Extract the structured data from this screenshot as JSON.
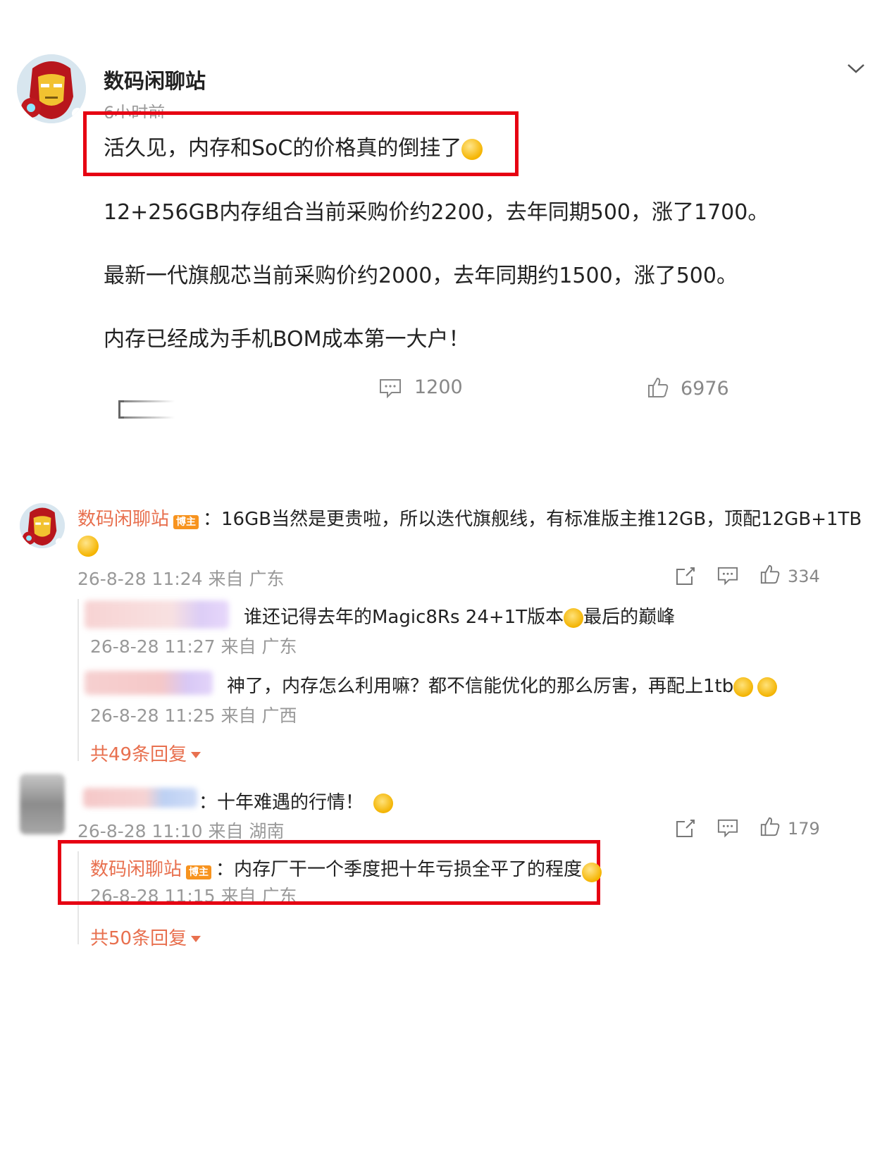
{
  "post": {
    "author": "数码闲聊站",
    "time": "6小时前",
    "lines": [
      "活久见，内存和SoC的价格真的倒挂了",
      "12+256GB内存组合当前采购价约2200，去年同期500，涨了1700。",
      "最新一代旗舰芯当前采购价约2000，去年同期约1500，涨了500。",
      "内存已经成为手机BOM成本第一大户！"
    ],
    "comment_count": "1200",
    "like_count": "6976"
  },
  "comments": [
    {
      "author": "数码闲聊站",
      "badge": "博主",
      "text": "：16GB当然是更贵啦，所以迭代旗舰线，有标准版主推12GB，顶配12GB+1TB",
      "meta": "26-8-28 11:24 来自 广东",
      "likes": "334",
      "replies": [
        {
          "text": "谁还记得去年的Magic8Rs 24+1T版本",
          "text_after": "最后的巅峰",
          "meta": "26-8-28 11:27 来自 广东"
        },
        {
          "text": "神了，内存怎么利用嘛？都不信能优化的那么厉害，再配上1tb",
          "meta": "26-8-28 11:25 来自 广西"
        }
      ],
      "reply_total": "共49条回复"
    },
    {
      "text": "：十年难遇的行情！",
      "meta": "26-8-28 11:10 来自 湖南",
      "likes": "179",
      "replies": [
        {
          "author": "数码闲聊站",
          "badge": "博主",
          "text": "：内存厂干一个季度把十年亏损全平了的程度",
          "meta": "26-8-28 11:15 来自 广东"
        }
      ],
      "reply_total": "共50条回复"
    }
  ],
  "colors": {
    "highlight_box": "#e60012",
    "name_accent": "#e8704f",
    "badge": "#f7931e"
  },
  "icons": [
    "chevron-down-icon",
    "share-icon",
    "comment-icon",
    "like-icon",
    "forward-icon",
    "emoji-icon"
  ]
}
